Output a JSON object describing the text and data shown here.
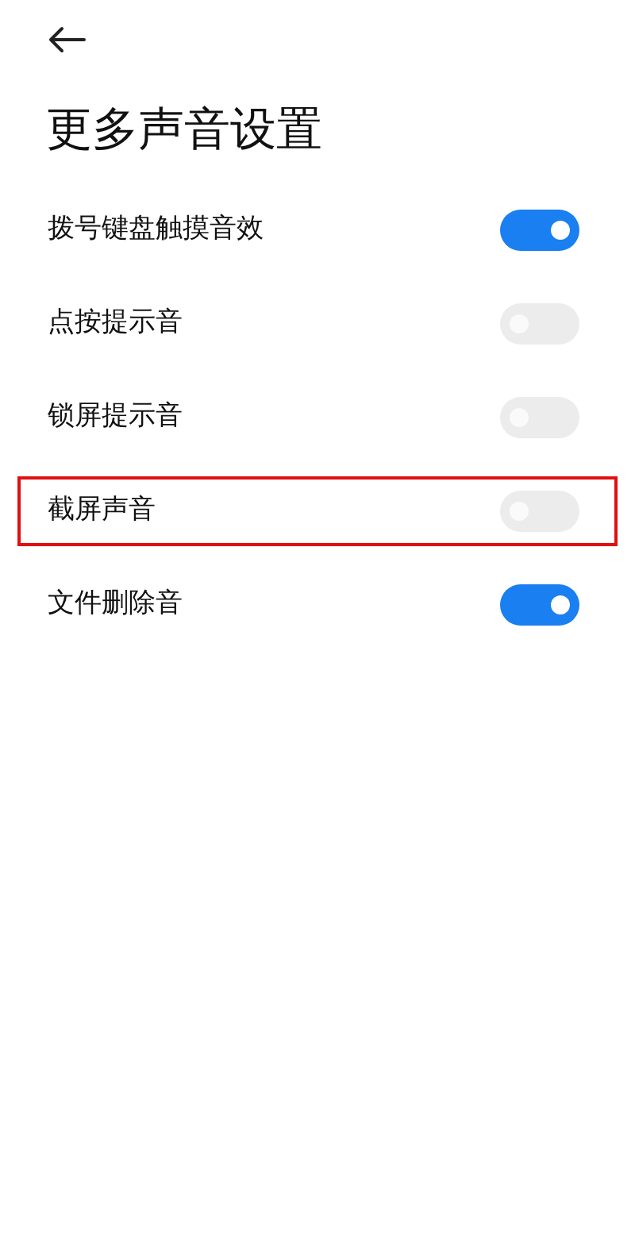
{
  "title": "更多声音设置",
  "settings": [
    {
      "label": "拨号键盘触摸音效",
      "on": true,
      "highlighted": false
    },
    {
      "label": "点按提示音",
      "on": false,
      "highlighted": false
    },
    {
      "label": "锁屏提示音",
      "on": false,
      "highlighted": false
    },
    {
      "label": "截屏声音",
      "on": false,
      "highlighted": true
    },
    {
      "label": "文件删除音",
      "on": true,
      "highlighted": false
    }
  ]
}
